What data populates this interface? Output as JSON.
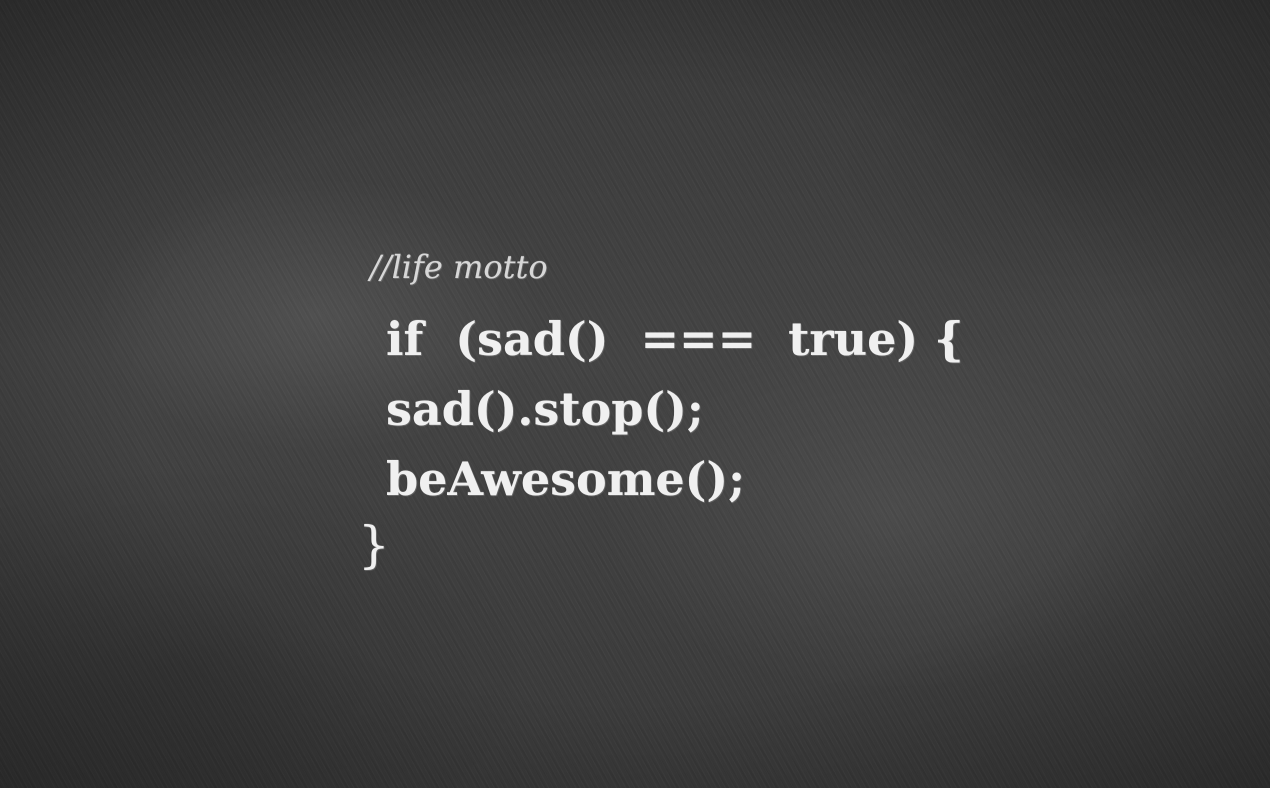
{
  "code": {
    "comment": "//life motto",
    "line1": "if  (sad()  ===  true) {",
    "line2": "sad().stop();",
    "line3": "beAwesome();",
    "line4": "}"
  },
  "colors": {
    "background": "#3c3c3c",
    "chalk": "#f0f0f0"
  }
}
